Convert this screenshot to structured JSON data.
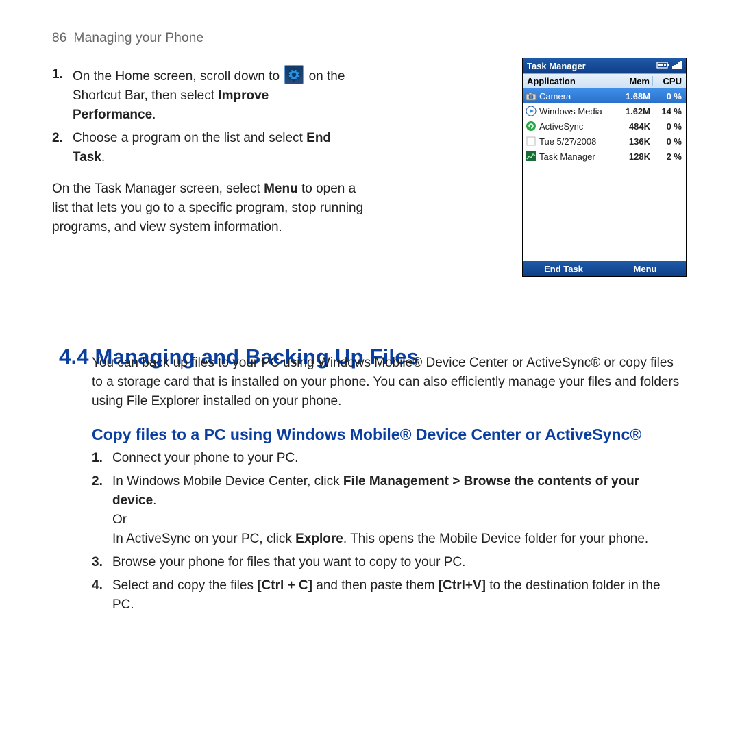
{
  "page": {
    "number": "86",
    "title": "Managing your Phone"
  },
  "topSteps": {
    "s1a": "On the Home screen, scroll down to",
    "s1b": "on the Shortcut Bar, then select",
    "s1bold": "Improve Performance",
    "s1dot": ".",
    "s2a": "Choose a program on the list and select",
    "s2bold": "End Task",
    "s2dot": "."
  },
  "afterSteps": {
    "p1a": "On the Task Manager screen, select",
    "p1bold": "Menu",
    "p1b": "to open a list that lets you go to a specific program, stop running programs, and view system information."
  },
  "tm": {
    "title": "Task Manager",
    "cols": {
      "app": "Application",
      "mem": "Mem",
      "cpu": "CPU"
    },
    "rows": [
      {
        "name": "Camera",
        "mem": "1.68M",
        "cpu": "0 %",
        "sel": true,
        "icon": "camera"
      },
      {
        "name": "Windows Media",
        "mem": "1.62M",
        "cpu": "14 %",
        "icon": "wmp"
      },
      {
        "name": "ActiveSync",
        "mem": "484K",
        "cpu": "0 %",
        "icon": "sync"
      },
      {
        "name": "Tue 5/27/2008",
        "mem": "136K",
        "cpu": "0 %",
        "icon": "blank"
      },
      {
        "name": "Task Manager",
        "mem": "128K",
        "cpu": "2 %",
        "icon": "tm"
      }
    ],
    "menu": {
      "left": "End Task",
      "right": "Menu"
    }
  },
  "section": {
    "h2": "4.4  Managing and Backing Up Files",
    "intro": "You can back up files to your PC using Windows Mobile® Device Center or ActiveSync® or copy files to a storage card that is installed on your phone. You can also efficiently manage your files and folders using File Explorer installed on your phone.",
    "h3": "Copy files to a PC using Windows Mobile® Device Center or ActiveSync®",
    "steps": {
      "s1": "Connect your phone to your PC.",
      "s2a": "In Windows Mobile Device Center, click",
      "s2bold": "File Management > Browse the contents of your device",
      "s2b": ".",
      "s2or": "Or",
      "s2c": "In ActiveSync on your PC, click",
      "s2bold2": "Explore",
      "s2d": ". This opens the Mobile Device folder for your phone.",
      "s3": "Browse your phone for files that you want to copy to your PC.",
      "s4a": "Select and copy the files",
      "s4bold1": "[Ctrl + C]",
      "s4b": "and then paste them",
      "s4bold2": "[Ctrl+V]",
      "s4c": "to the destination folder in the PC."
    }
  }
}
